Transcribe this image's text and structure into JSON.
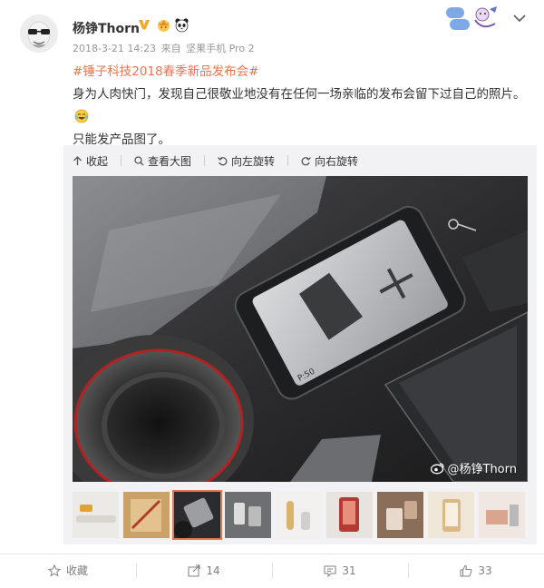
{
  "author": {
    "name": "杨铮Thorn",
    "timestamp": "2018-3-21 14:23",
    "source_prefix": "来自",
    "source": "坚果手机 Pro 2"
  },
  "post": {
    "topic": "#锤子科技2018春季新品发布会#",
    "line1": "身为人肉快门，发现自己很敬业地没有在任何一场亲临的发布会留下过自己的照片。",
    "line2": "只能发产品图了。"
  },
  "toolbar": {
    "collapse": "收起",
    "view_large": "查看大图",
    "rotate_left": "向左旋转",
    "rotate_right": "向右旋转"
  },
  "image": {
    "watermark": "@杨铮Thorn",
    "screen_time": "P:50"
  },
  "thumbnails": {
    "count": 9,
    "active_index": 2
  },
  "actions": {
    "favorite_label": "收藏",
    "repost_count": "14",
    "comment_count": "31",
    "like_count": "33"
  },
  "colors": {
    "accent": "#eb7350",
    "meta_text": "#999999",
    "action_text": "#808080"
  }
}
